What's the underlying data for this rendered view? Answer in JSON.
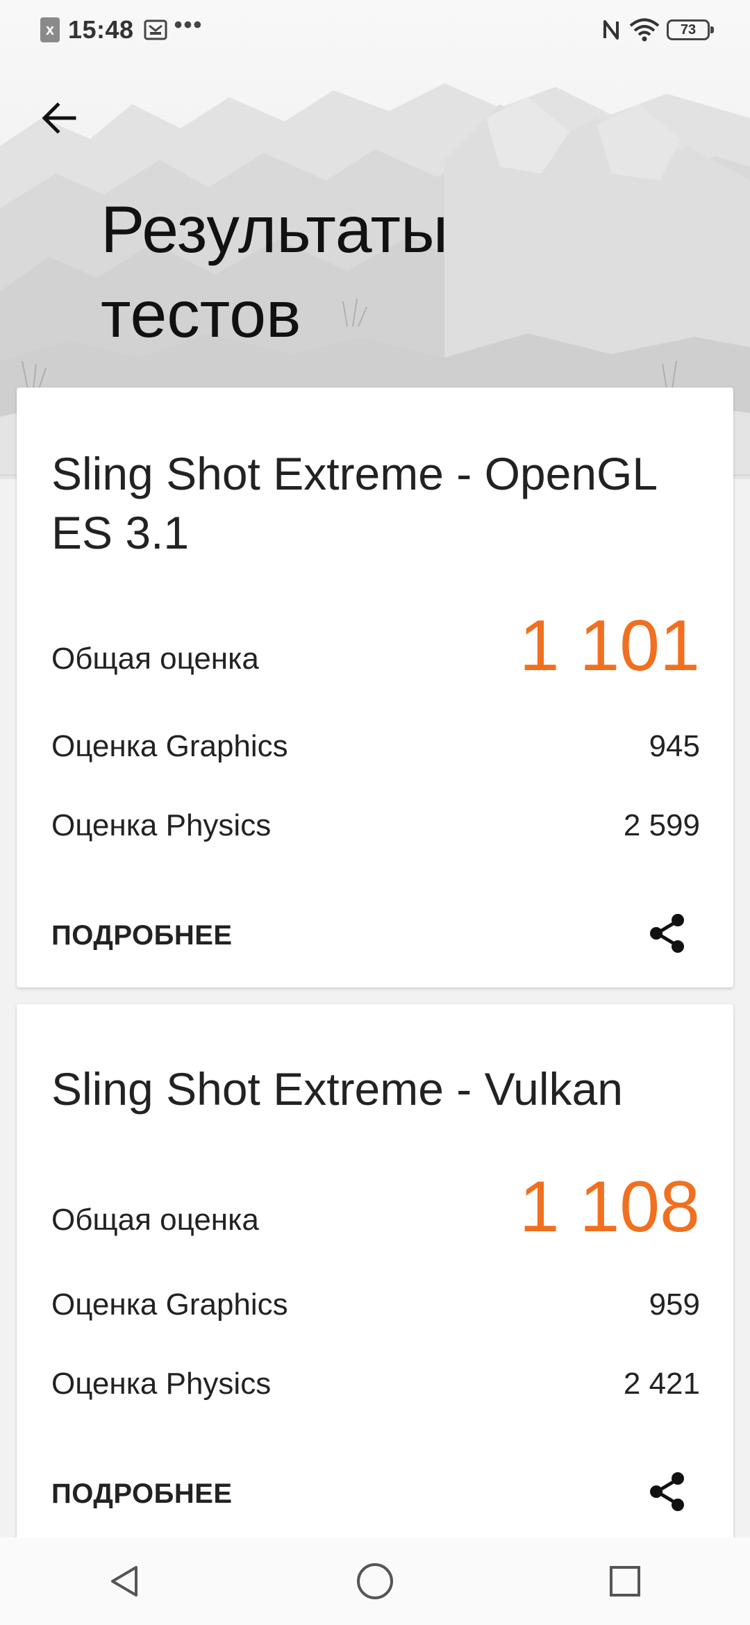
{
  "status_bar": {
    "time": "15:48",
    "close_badge": "x",
    "overflow": "•••",
    "battery": "73"
  },
  "page": {
    "title_line1": "Результаты",
    "title_line2": "тестов"
  },
  "results": [
    {
      "title_line1": "Sling Shot Extreme - OpenGL",
      "title_line2": "ES 3.1",
      "overall_label": "Общая оценка",
      "overall_value": "1 101",
      "graphics_label": "Оценка Graphics",
      "graphics_value": "945",
      "physics_label": "Оценка Physics",
      "physics_value": "2 599",
      "more_label": "ПОДРОБНЕЕ"
    },
    {
      "title_line1": "Sling Shot Extreme - Vulkan",
      "title_line2": "",
      "overall_label": "Общая оценка",
      "overall_value": "1 108",
      "graphics_label": "Оценка Graphics",
      "graphics_value": "959",
      "physics_label": "Оценка Physics",
      "physics_value": "2 421",
      "more_label": "ПОДРОБНЕЕ"
    }
  ],
  "colors": {
    "accent": "#f07020",
    "text": "#222222"
  },
  "icons": {
    "back": "arrow-back-icon",
    "share": "share-icon",
    "nav_back": "triangle-back-icon",
    "nav_home": "circle-home-icon",
    "nav_recents": "square-recents-icon"
  }
}
